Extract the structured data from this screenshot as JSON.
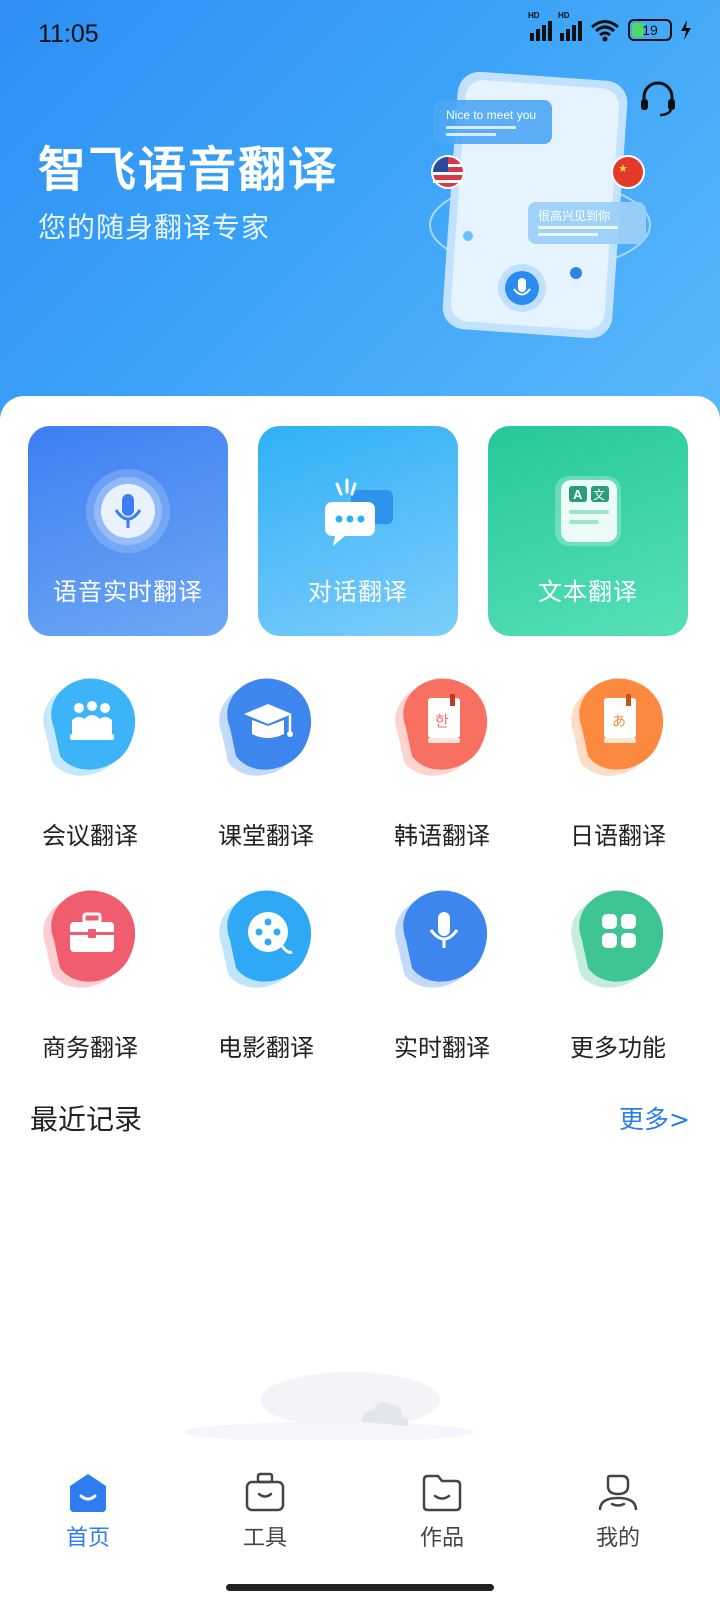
{
  "status_bar": {
    "time": "11:05",
    "hd1": "HD",
    "hd2": "HD",
    "battery": "19"
  },
  "hero": {
    "title": "智飞语音翻译",
    "subtitle": "您的随身翻译专家",
    "bubble_en": "Nice to meet you",
    "bubble_zh": "很高兴见到你"
  },
  "main_tiles": [
    {
      "label": "语音实时翻译",
      "icon": "microphone-icon"
    },
    {
      "label": "对话翻译",
      "icon": "chat-bubbles-icon"
    },
    {
      "label": "文本翻译",
      "icon": "text-translate-icon"
    }
  ],
  "functions": [
    {
      "label": "会议翻译",
      "icon": "meeting-icon",
      "color": "#3db4f7"
    },
    {
      "label": "课堂翻译",
      "icon": "graduation-cap-icon",
      "color": "#3c86ee"
    },
    {
      "label": "韩语翻译",
      "icon": "korean-book-icon",
      "color": "#f77062"
    },
    {
      "label": "日语翻译",
      "icon": "japanese-book-icon",
      "color": "#fb8a40"
    },
    {
      "label": "商务翻译",
      "icon": "briefcase-icon",
      "color": "#ef5d6e"
    },
    {
      "label": "电影翻译",
      "icon": "film-reel-icon",
      "color": "#2fa9f5"
    },
    {
      "label": "实时翻译",
      "icon": "microphone-icon",
      "color": "#3c86ee"
    },
    {
      "label": "更多功能",
      "icon": "grid-icon",
      "color": "#3fc493"
    }
  ],
  "recent": {
    "title": "最近记录",
    "more": "更多>"
  },
  "tabbar": [
    {
      "label": "首页",
      "icon": "home-icon",
      "active": true
    },
    {
      "label": "工具",
      "icon": "toolbox-icon",
      "active": false
    },
    {
      "label": "作品",
      "icon": "folder-icon",
      "active": false
    },
    {
      "label": "我的",
      "icon": "profile-icon",
      "active": false
    }
  ],
  "colors": {
    "hero_start": "#2f8ff5",
    "hero_end": "#5bb8fb",
    "accent": "#2f7cf0",
    "more_link": "#2d7de8"
  }
}
